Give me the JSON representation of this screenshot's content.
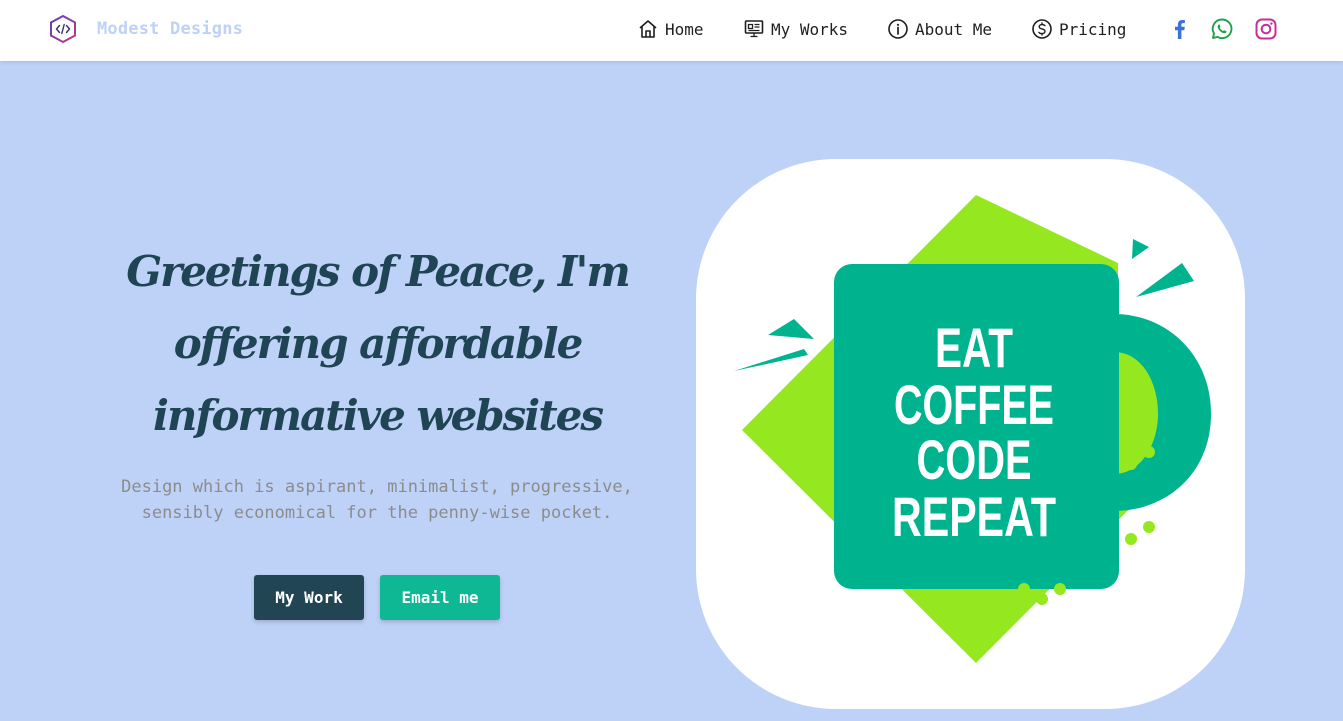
{
  "navbar": {
    "brand_name": "Modest Designs",
    "brand_icon": "code-hexagon-icon",
    "links": [
      {
        "label": "Home",
        "icon": "home-icon"
      },
      {
        "label": "My Works",
        "icon": "monitor-icon"
      },
      {
        "label": "About Me",
        "icon": "info-circle-icon"
      },
      {
        "label": "Pricing",
        "icon": "dollar-circle-icon"
      }
    ],
    "socials": [
      {
        "name": "facebook-icon",
        "color": "#3b5998"
      },
      {
        "name": "whatsapp-icon",
        "color": "#25a244"
      },
      {
        "name": "instagram-icon",
        "color": "#c13584"
      }
    ]
  },
  "hero": {
    "title": "Greetings of Peace, I'm offering affordable informative websites",
    "subtitle": "Design which is aspirant, minimalist, progressive, sensibly economical for the penny-wise pocket.",
    "primary_button": "My Work",
    "secondary_button": "Email me",
    "image": {
      "name": "coffee-mug-illustration",
      "mug_text": [
        "EAT",
        "COFFEE",
        "CODE",
        "REPEAT"
      ]
    }
  },
  "colors": {
    "background": "#bed1f7",
    "title_text": "#1f4453",
    "primary_button": "#214553",
    "secondary_button": "#0fb894",
    "mug": "#00b38f",
    "accent_lime": "#95e820"
  }
}
